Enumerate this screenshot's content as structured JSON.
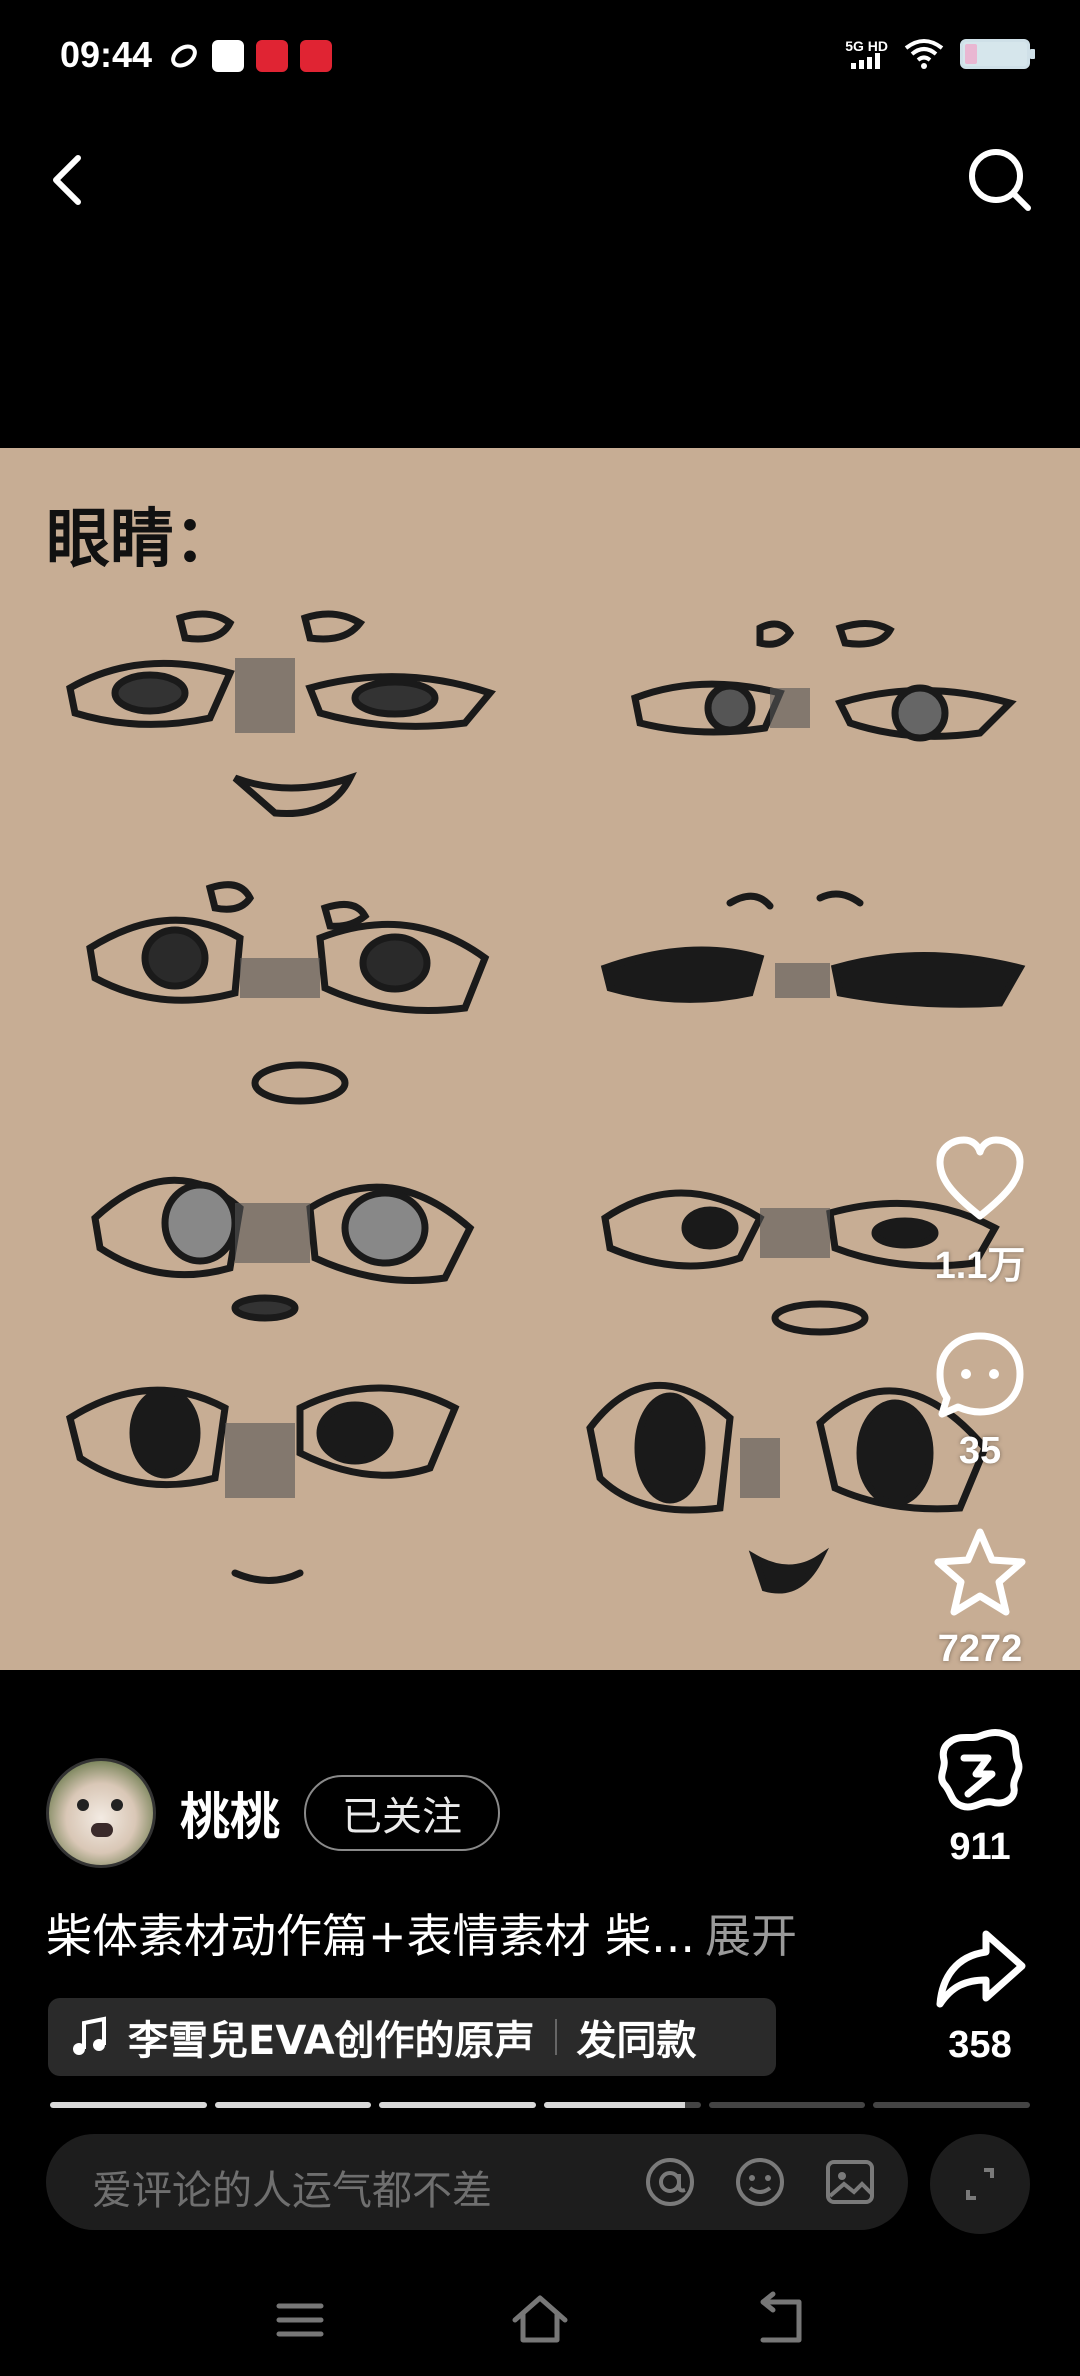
{
  "status_bar": {
    "time": "09:44",
    "network": "5G HD",
    "icons": [
      "link-icon",
      "message-icon",
      "app-icon-red",
      "xiaohongshu-icon"
    ]
  },
  "nav": {
    "back_icon": "chevron-left-icon",
    "search_icon": "search-icon"
  },
  "artwork": {
    "title": "眼睛："
  },
  "actions": {
    "like_count": "1.1万",
    "comment_count": "35",
    "favorite_count": "7272",
    "flag_count": "911",
    "share_count": "358"
  },
  "author": {
    "name": "桃桃",
    "follow_label": "已关注"
  },
  "caption": {
    "text": "柴体素材动作篇+表情素材 柴...",
    "more_label": "展开"
  },
  "music": {
    "track": "李雪兒EVA创作的原声",
    "same_label": "发同款"
  },
  "progress": {
    "segments": 6,
    "active_index": 3,
    "active_fill": 0.9
  },
  "comment_bar": {
    "placeholder": "爱评论的人运气都不差"
  },
  "colors": {
    "background": "#000000",
    "artwork_paper": "#c7ad94",
    "pill_background": "#2a2a2a"
  }
}
